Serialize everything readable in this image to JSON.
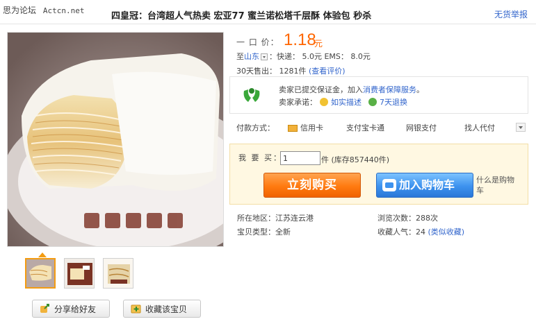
{
  "watermark": {
    "site": "思为论坛",
    "url": "Actcn.net"
  },
  "title": "四皇冠：台湾超人气热卖 宏亚77 蜜兰诺松塔千层酥 体验包 秒杀",
  "report_link": "无货举报",
  "price": {
    "label": "一 口 价：",
    "value": "1.18",
    "unit": "元"
  },
  "shipping": {
    "to_label": "至",
    "location": "山东",
    "text": "：快递： 5.0元  EMS： 8.0元"
  },
  "sales": {
    "text": "30天售出： 1281件",
    "link": "(查看评价)"
  },
  "promise": {
    "line1_prefix": "卖家已提交保证金，加入",
    "line1_link": "消费者保障服务",
    "line1_suffix": "。",
    "line2_label": "卖家承诺：",
    "badge1": "如实描述",
    "badge2": "7天退换"
  },
  "payment": {
    "label": "付款方式：",
    "methods": [
      "信用卡",
      "支付宝卡通",
      "网银支付",
      "找人代付"
    ]
  },
  "buy": {
    "qty_label": "我 要 买：",
    "qty_value": "1",
    "qty_unit": "件 (库存857440件)",
    "buy_now": "立刻购买",
    "add_cart": "加入购物车",
    "what_cart": "什么是购物车"
  },
  "details": {
    "region_label": "所在地区：",
    "region": "江苏连云港",
    "views_label": "浏览次数：",
    "views": "288次",
    "type_label": "宝贝类型：",
    "type": "全新",
    "fav_label": "收藏人气：",
    "fav": "24",
    "similar_link": "(类似收藏)"
  },
  "actions": {
    "share": "分享给好友",
    "favorite": "收藏该宝贝"
  },
  "colors": {
    "price": "#ff6600",
    "link": "#3366cc",
    "buy_btn": "#ff7a10",
    "cart_btn": "#3d92ee",
    "buy_panel_bg": "#fff8e2"
  }
}
